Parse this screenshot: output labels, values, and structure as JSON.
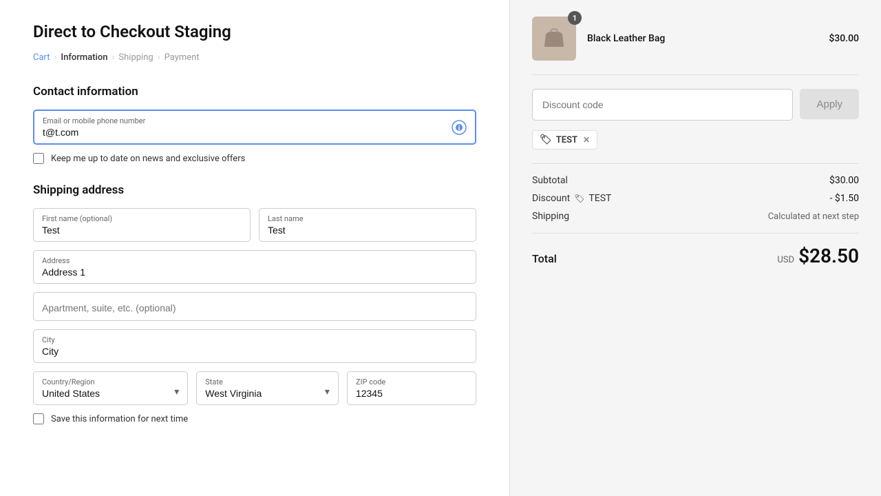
{
  "page": {
    "title": "Direct to Checkout Staging"
  },
  "breadcrumb": {
    "cart": "Cart",
    "information": "Information",
    "shipping": "Shipping",
    "payment": "Payment"
  },
  "contact": {
    "section_title": "Contact information",
    "email_label": "Email or mobile phone number",
    "email_value": "t@t.com",
    "email_placeholder": "Email or mobile phone number",
    "newsletter_label": "Keep me up to date on news and exclusive offers"
  },
  "shipping": {
    "section_title": "Shipping address",
    "first_name_label": "First name (optional)",
    "first_name_value": "Test",
    "last_name_label": "Last name",
    "last_name_value": "Test",
    "address_label": "Address",
    "address_value": "Address 1",
    "address_placeholder": "Address",
    "apt_label": "Apartment, suite, etc. (optional)",
    "apt_value": "",
    "apt_placeholder": "Apartment, suite, etc. (optional)",
    "city_label": "City",
    "city_value": "City",
    "country_label": "Country/Region",
    "country_value": "United States",
    "state_label": "State",
    "state_value": "West Virginia",
    "zip_label": "ZIP code",
    "zip_value": "12345",
    "save_label": "Save this information for next time"
  },
  "order": {
    "product_name": "Black Leather Bag",
    "product_price": "$30.00",
    "product_badge": "1",
    "discount_placeholder": "Discount code",
    "apply_label": "Apply",
    "discount_tag": "TEST",
    "subtotal_label": "Subtotal",
    "subtotal_value": "$30.00",
    "discount_label": "Discount",
    "discount_code_display": "TEST",
    "discount_value": "- $1.50",
    "shipping_label": "Shipping",
    "shipping_value": "Calculated at next step",
    "total_label": "Total",
    "total_currency": "USD",
    "total_amount": "$28.50"
  }
}
